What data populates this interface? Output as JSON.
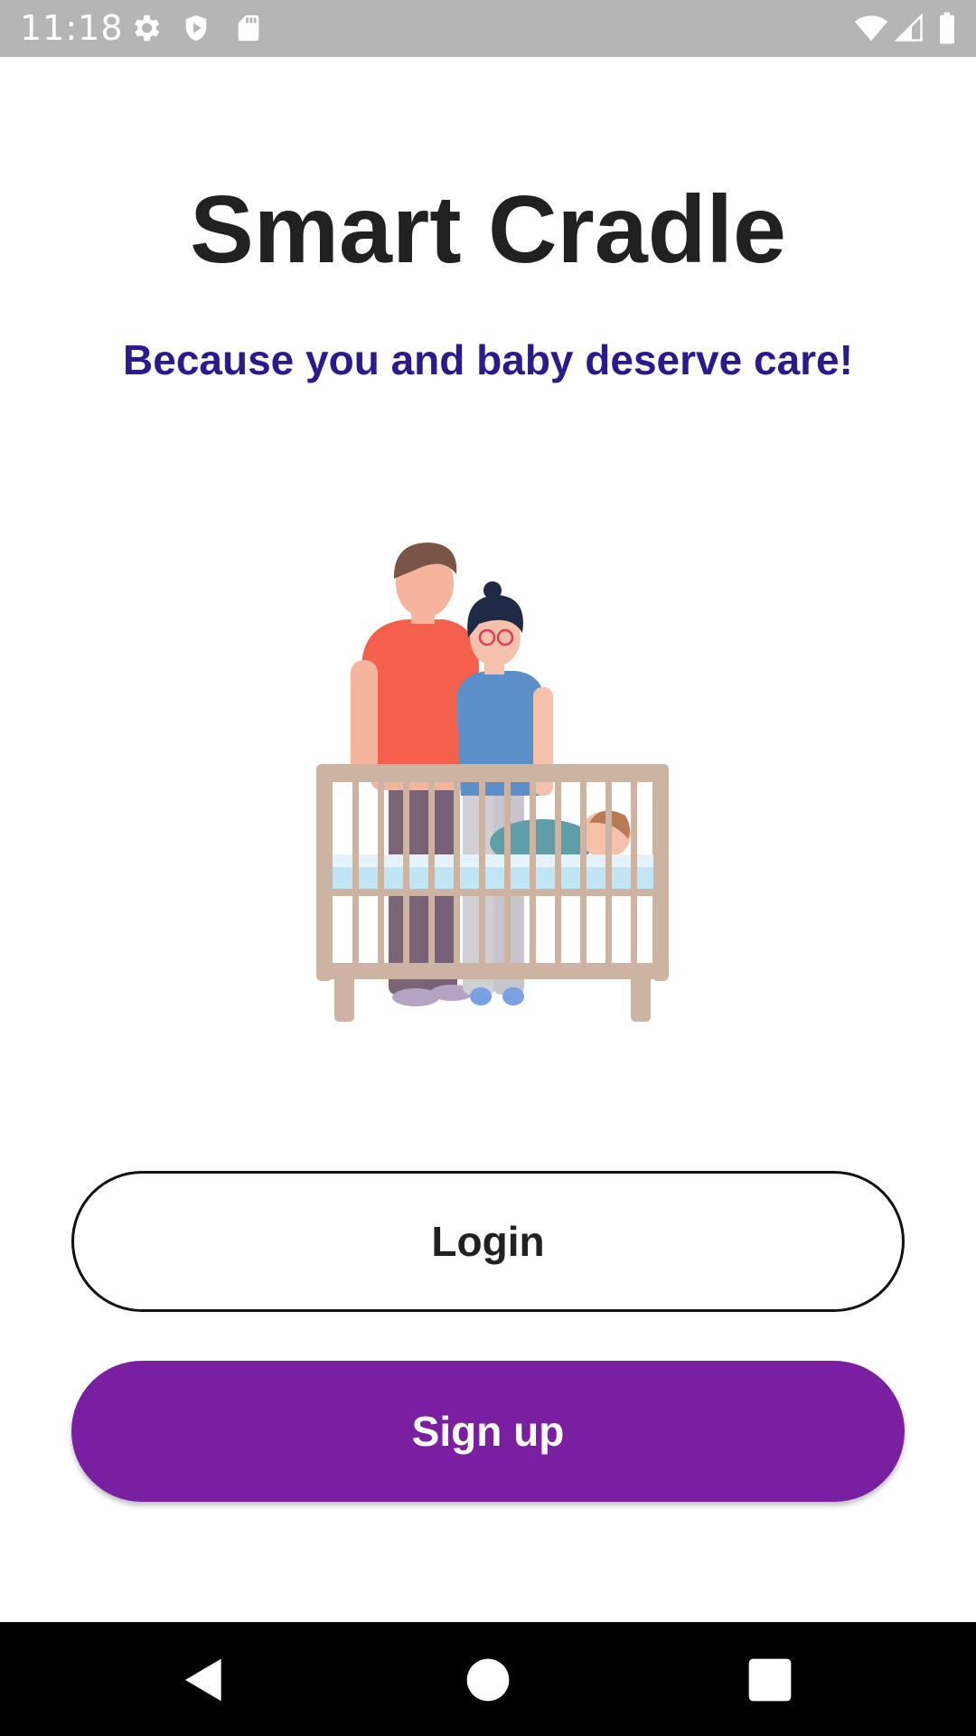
{
  "status_bar": {
    "time": "11:18",
    "icons": [
      "gear-icon",
      "shield-icon",
      "sd-card-icon",
      "wifi-icon",
      "signal-icon",
      "battery-icon"
    ]
  },
  "app": {
    "title": "Smart Cradle",
    "tagline": "Because you and baby deserve care!"
  },
  "buttons": {
    "login_label": "Login",
    "signup_label": "Sign up"
  },
  "colors": {
    "tagline": "#2a1a8f",
    "signup_bg": "#7b1fa2",
    "title": "#212121"
  },
  "nav_bar": {
    "icons": [
      "back-icon",
      "home-icon",
      "recents-icon"
    ]
  }
}
